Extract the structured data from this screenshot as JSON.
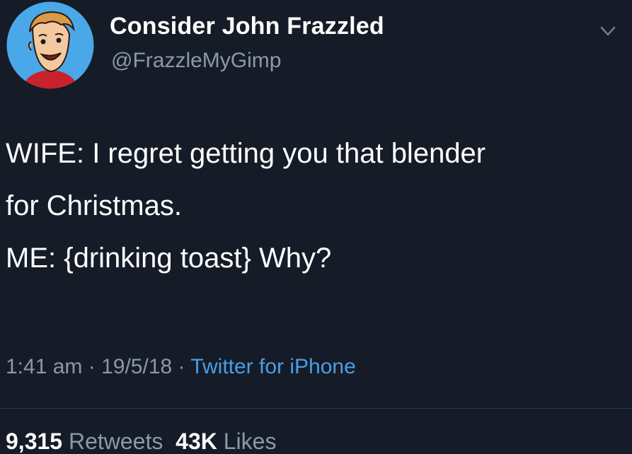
{
  "user": {
    "display_name": "Consider John Frazzled",
    "handle": "@FrazzleMyGimp",
    "avatar_icon": "cartoon-avatar-icon"
  },
  "tweet": {
    "lines": [
      "WIFE: I regret getting you that blender",
      "for Christmas.",
      "ME: {drinking toast} Why?"
    ]
  },
  "meta": {
    "time": "1:41 am",
    "separator": "·",
    "date": "19/5/18",
    "source": "Twitter for iPhone"
  },
  "stats": {
    "retweets_count": "9,315",
    "retweets_label": "Retweets",
    "likes_count": "43K",
    "likes_label": "Likes"
  },
  "colors": {
    "background": "#151c27",
    "text": "#ffffff",
    "muted": "#8a99a8",
    "link": "#4a9ee6",
    "divider": "#2f3a46"
  }
}
